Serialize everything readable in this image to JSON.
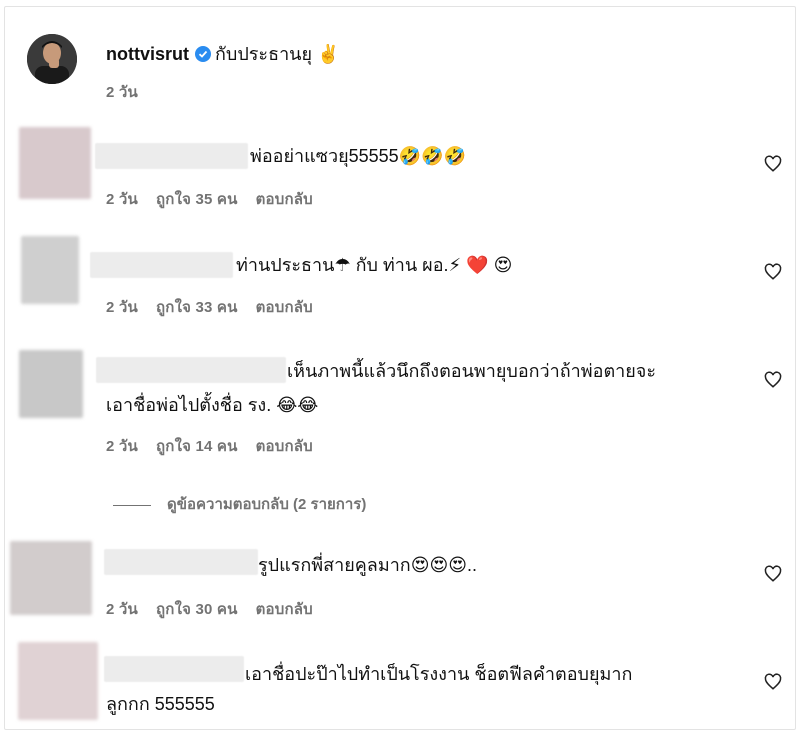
{
  "post": {
    "username": "nottvisrut",
    "caption": "กับประธานยุ ✌️",
    "time": "2 วัน"
  },
  "comments": [
    {
      "text": "พ่ออย่าแซวยุ55555",
      "emojis": "🤣🤣🤣",
      "time": "2 วัน",
      "likes": "ถูกใจ 35 คน",
      "reply": "ตอบกลับ",
      "avatar_color": "#d8c9cc"
    },
    {
      "text": "ท่านประธาน☂ กับ ท่าน ผอ.⚡ ❤️",
      "emojis": "😍",
      "time": "2 วัน",
      "likes": "ถูกใจ 33 คน",
      "reply": "ตอบกลับ",
      "avatar_color": "#cfcfcf"
    },
    {
      "text_line1": "เห็นภาพนี้แล้วนึกถึงตอนพายุบอกว่าถ้าพ่อตายจะ",
      "text_line2": "เอาชื่อพ่อไปตั้งชื่อ รง.",
      "emojis": "😂😂",
      "time": "2 วัน",
      "likes": "ถูกใจ 14 คน",
      "reply": "ตอบกลับ",
      "view_replies": "ดูข้อความตอบกลับ (2 รายการ)",
      "avatar_color": "#c8c8c8"
    },
    {
      "text": "รูปแรกพี่สายคูลมาก",
      "emojis": "😍😍😍",
      "suffix": "..",
      "time": "2 วัน",
      "likes": "ถูกใจ 30 คน",
      "reply": "ตอบกลับ",
      "avatar_color": "#d2cccc"
    },
    {
      "text_line1": "เอาชื่อปะป๊าไปทำเป็นโรงงาน ช็อตฟีลคำตอบยุมาก",
      "text_line2": "ลูกกก 555555",
      "avatar_color": "#e0d2d4"
    }
  ]
}
